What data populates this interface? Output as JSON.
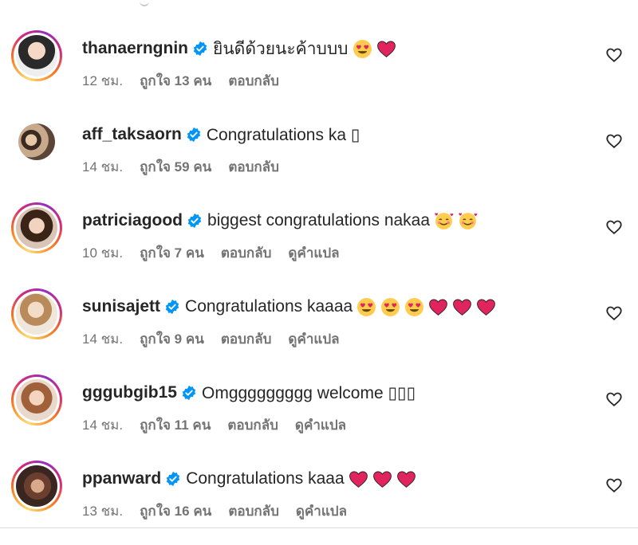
{
  "comments": [
    {
      "username": "thanaerngnin",
      "verified": true,
      "text": "ยินดีด้วยนะค้าบบบ",
      "emojis": [
        "heart-eyes",
        "red-heart"
      ],
      "time": "12 ชม.",
      "likes": "ถูกใจ 13 คน",
      "reply": "ตอบกลับ",
      "translate": ""
    },
    {
      "username": "aff_taksaorn",
      "verified": true,
      "text": "Congratulations ka ▯",
      "emojis": [],
      "time": "14 ชม.",
      "likes": "ถูกใจ 59 คน",
      "reply": "ตอบกลับ",
      "translate": ""
    },
    {
      "username": "patriciagood",
      "verified": true,
      "text": "biggest congratulations nakaa",
      "emojis": [
        "smiling-hearts",
        "smiling-hearts"
      ],
      "time": "10 ชม.",
      "likes": "ถูกใจ 7 คน",
      "reply": "ตอบกลับ",
      "translate": "ดูคำแปล"
    },
    {
      "username": "sunisajett",
      "verified": true,
      "text": "Congratulations kaaaa",
      "emojis": [
        "heart-eyes",
        "heart-eyes",
        "heart-eyes",
        "red-heart",
        "red-heart",
        "red-heart"
      ],
      "time": "14 ชม.",
      "likes": "ถูกใจ 9 คน",
      "reply": "ตอบกลับ",
      "translate": "ดูคำแปล"
    },
    {
      "username": "gggubgib15",
      "verified": true,
      "text": "Omggggggggg welcome ▯▯▯",
      "emojis": [],
      "time": "14 ชม.",
      "likes": "ถูกใจ 11 คน",
      "reply": "ตอบกลับ",
      "translate": "ดูคำแปล"
    },
    {
      "username": "ppanward",
      "verified": true,
      "text": "Congratulations kaaa",
      "emojis": [
        "red-heart",
        "red-heart",
        "red-heart"
      ],
      "time": "13 ชม.",
      "likes": "ถูกใจ 16 คน",
      "reply": "ตอบกลับ",
      "translate": "ดูคำแปล"
    }
  ],
  "colors": {
    "text": "#262626",
    "meta": "#737373",
    "verified_blue": "#0095f6",
    "heart_red": "#e0245e",
    "divider": "#dbdbdb"
  },
  "icons": {
    "verified": "verified-badge-icon",
    "like": "heart-outline-icon"
  }
}
